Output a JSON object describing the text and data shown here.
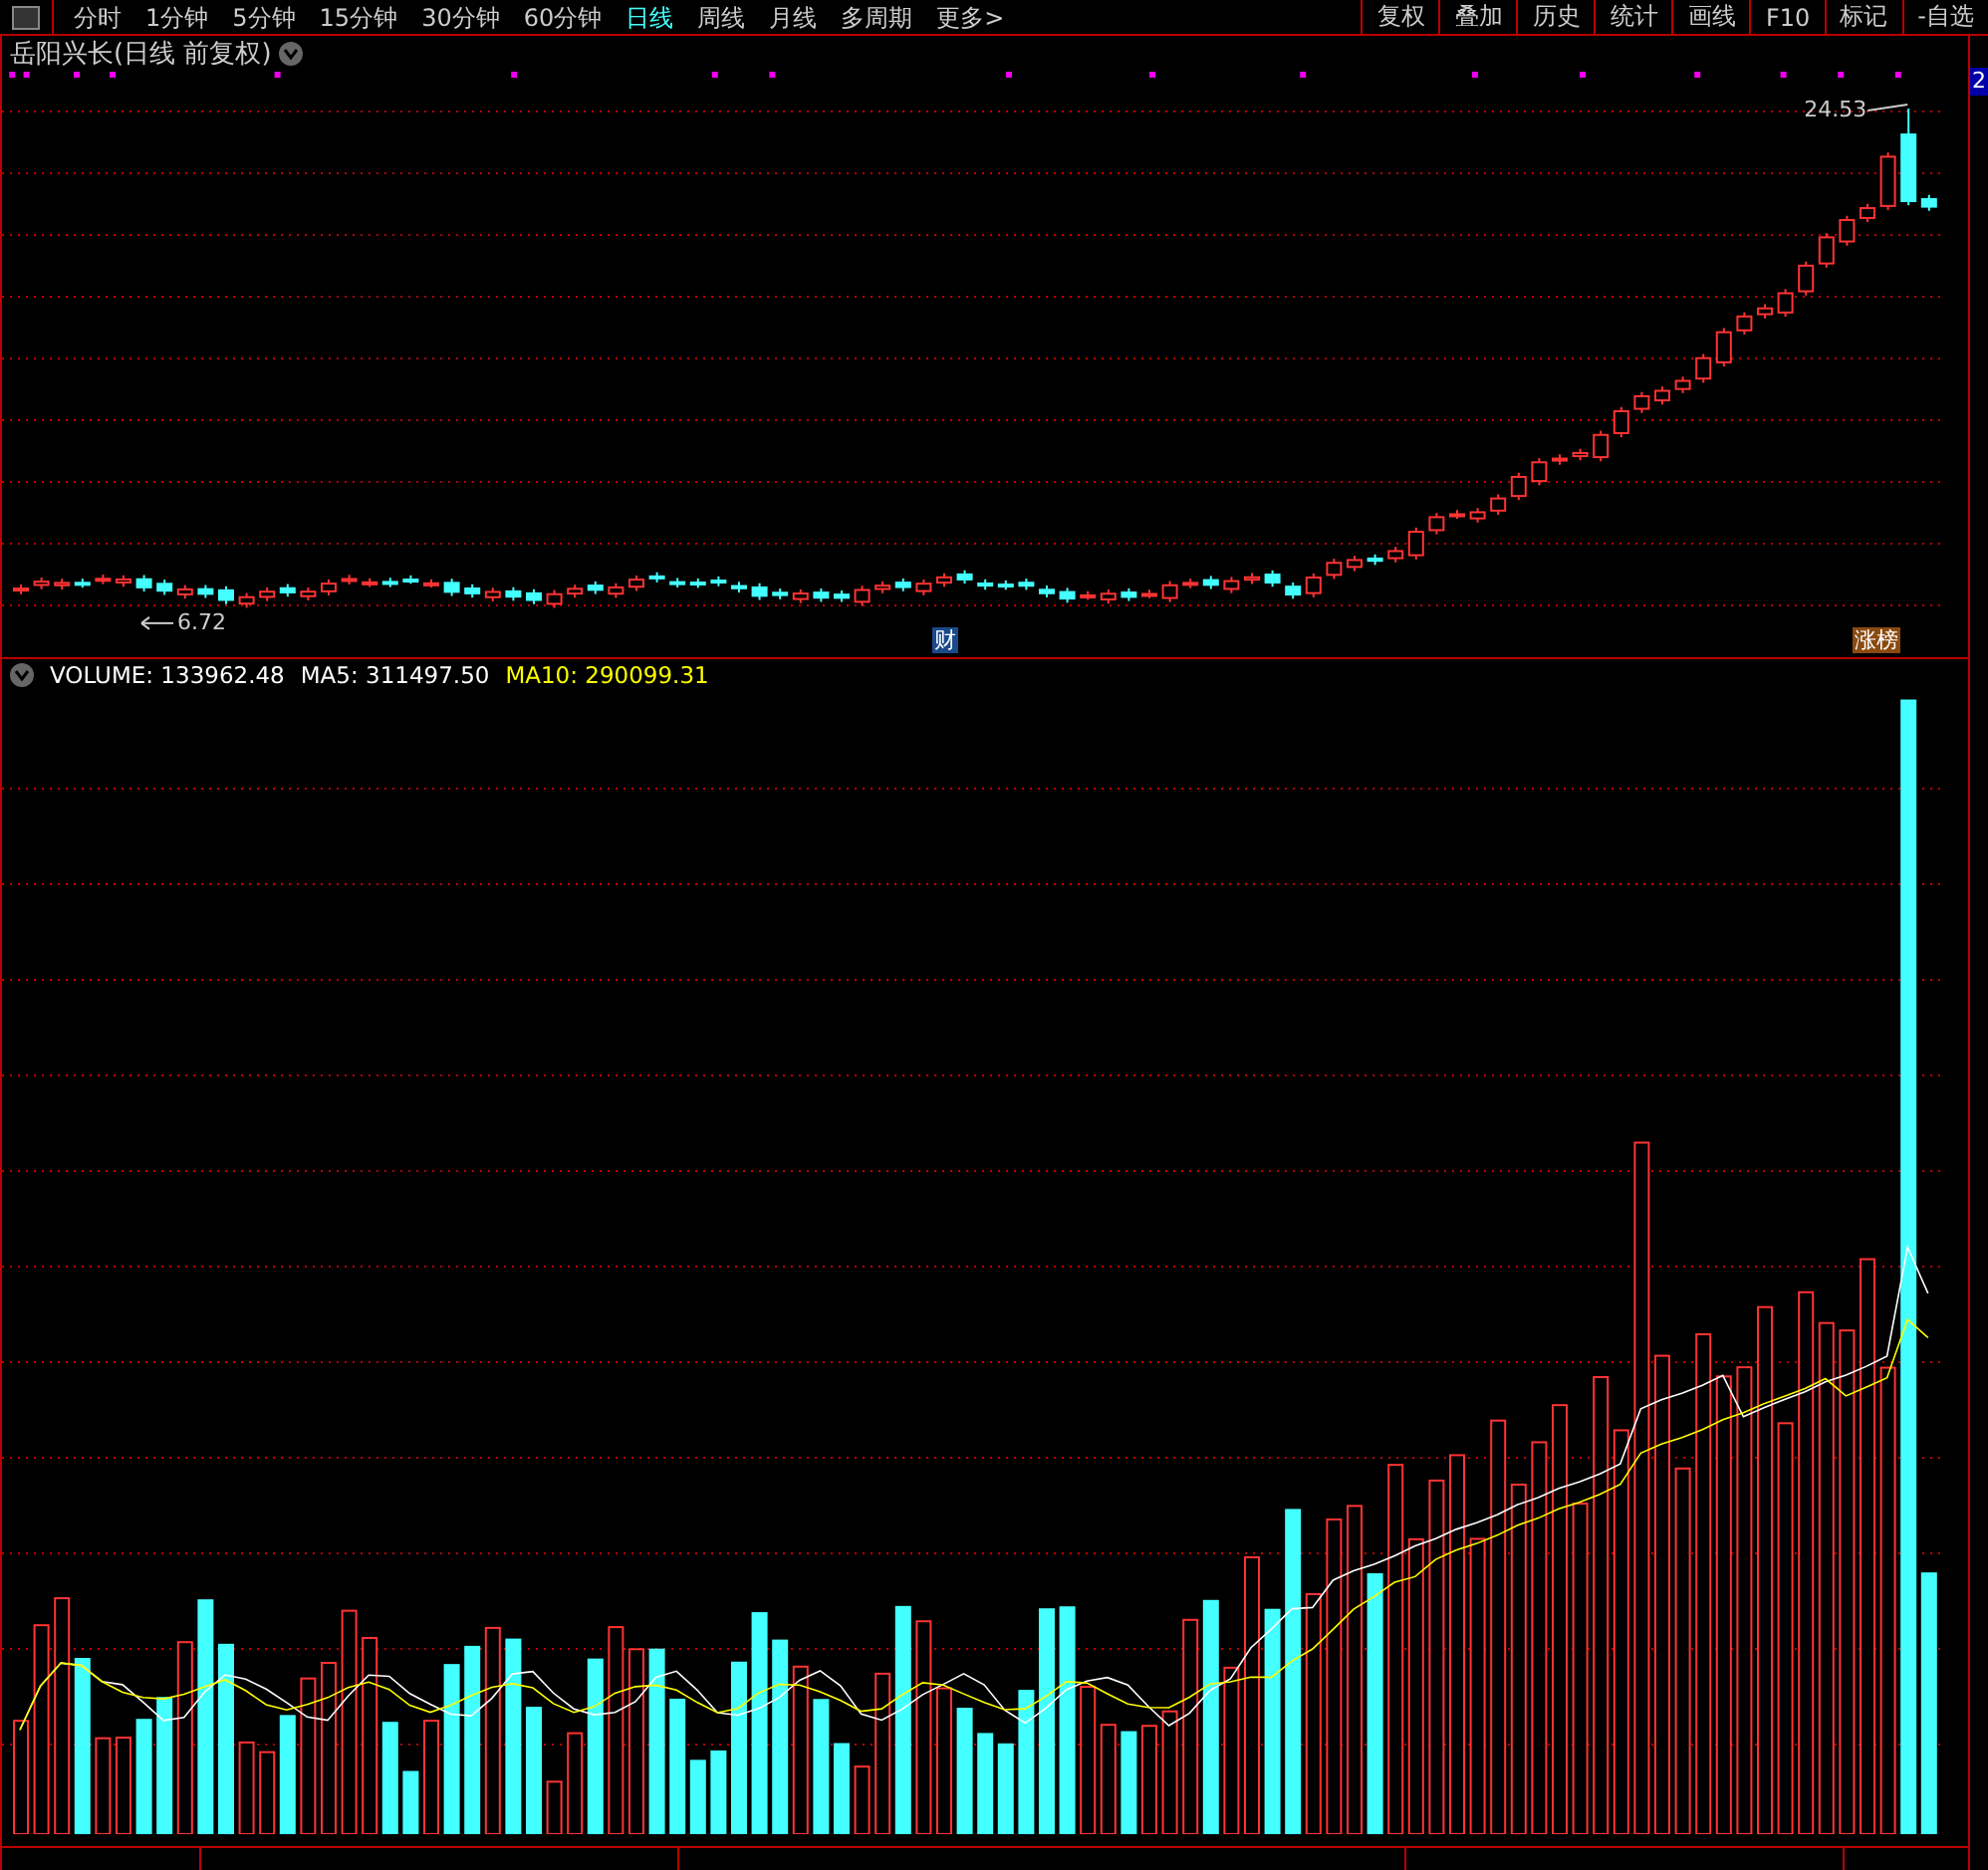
{
  "toolbar": {
    "periods": [
      {
        "label": "分时",
        "selected": false
      },
      {
        "label": "1分钟",
        "selected": false
      },
      {
        "label": "5分钟",
        "selected": false
      },
      {
        "label": "15分钟",
        "selected": false
      },
      {
        "label": "30分钟",
        "selected": false
      },
      {
        "label": "60分钟",
        "selected": false
      },
      {
        "label": "日线",
        "selected": true
      },
      {
        "label": "周线",
        "selected": false
      },
      {
        "label": "月线",
        "selected": false
      },
      {
        "label": "多周期",
        "selected": false
      },
      {
        "label": "更多>",
        "selected": false
      }
    ],
    "tools": [
      "复权",
      "叠加",
      "历史",
      "统计",
      "画线",
      "F10",
      "标记",
      "-自选"
    ]
  },
  "price_chart": {
    "title": "岳阳兴长(日线 前复权)",
    "high_label": "24.53",
    "low_label": "6.72",
    "badges": [
      {
        "label": "财",
        "kind": "finance"
      },
      {
        "label": "涨榜",
        "kind": "rank"
      }
    ]
  },
  "volume_chart": {
    "legend": [
      {
        "label": "VOLUME: 133962.48",
        "color": "#ffffff"
      },
      {
        "label": "MA5: 311497.50",
        "color": "#ffffff"
      },
      {
        "label": "MA10: 290099.31",
        "color": "#ffff00"
      }
    ]
  },
  "axis_badge": "2"
}
